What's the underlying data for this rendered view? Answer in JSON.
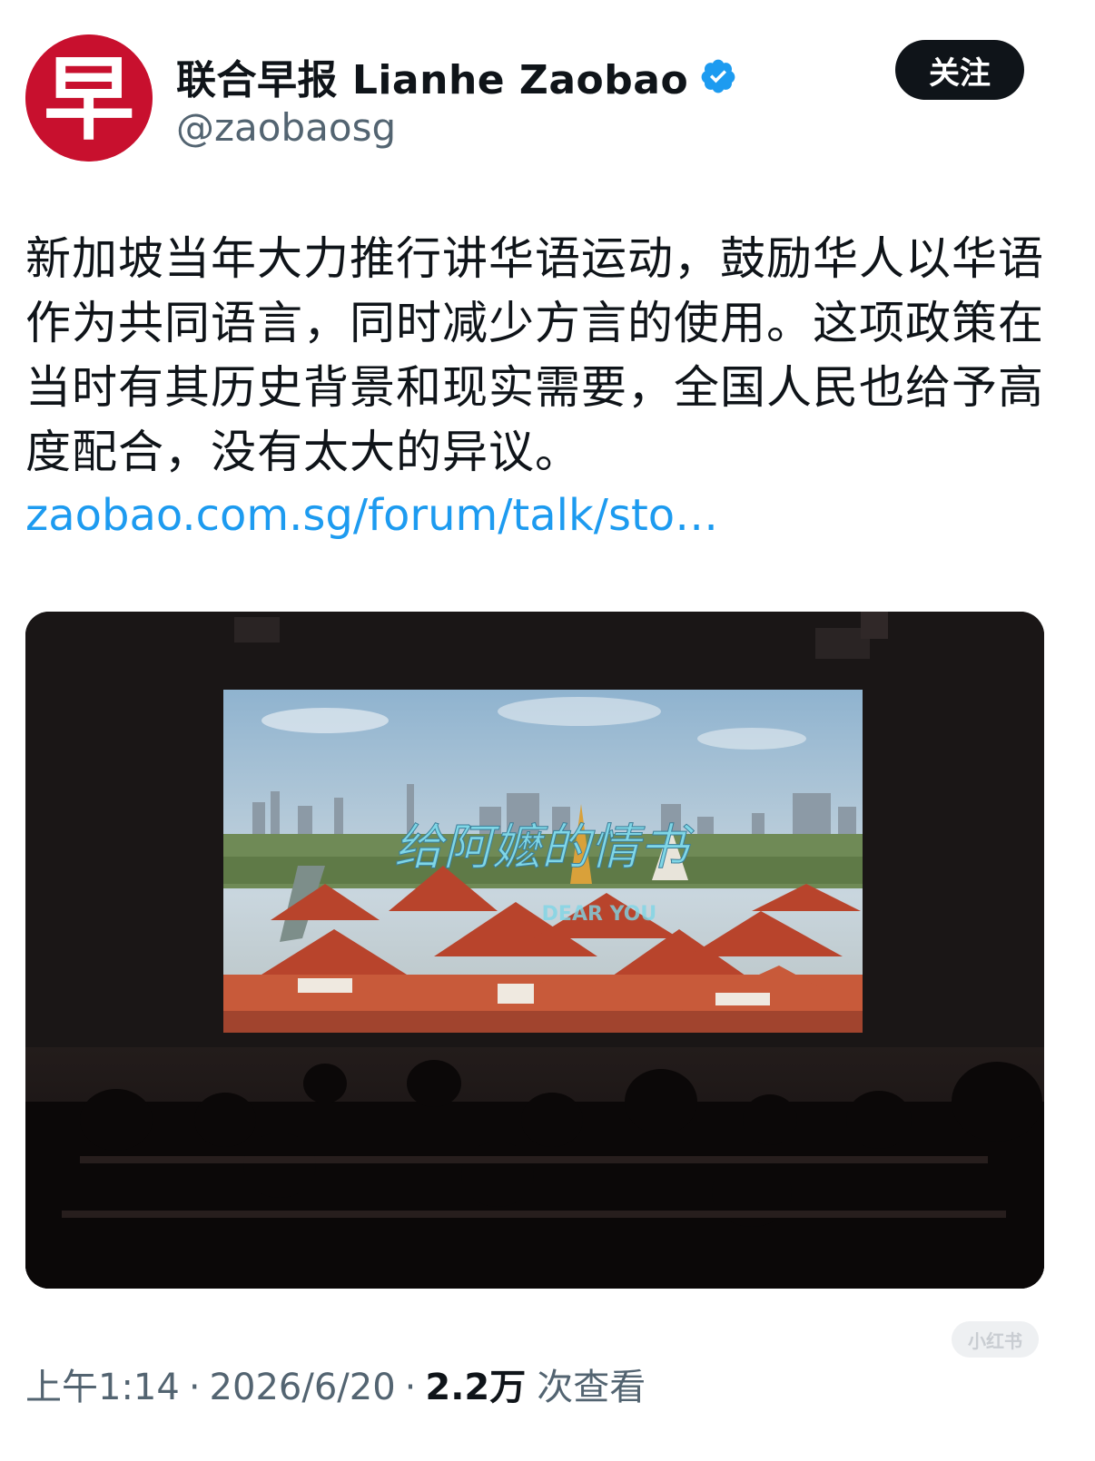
{
  "account": {
    "display_name": "联合早报 Lianhe Zaobao",
    "handle": "@zaobaosg",
    "avatar_glyph": "早",
    "verified": true,
    "follow_label": "关注"
  },
  "tweet": {
    "text": "新加坡当年大力推行讲华语运动，鼓励华人以华语作为共同语言，同时减少方言的使用。这项政策在当时有其历史背景和现实需要，全国人民也给予高度配合，没有太大的异议。",
    "link_text": "zaobao.com.sg/forum/talk/sto…",
    "media": {
      "title_text": "给阿嬷的情书",
      "subtitle_text": "DEAR YOU"
    }
  },
  "meta": {
    "time": "上午1:14",
    "separator": "·",
    "date": "2026/6/20",
    "views_count": "2.2万",
    "views_label": "次查看"
  },
  "watermark": "小红书",
  "colors": {
    "brand_red": "#c8102e",
    "link_blue": "#1d9bf0",
    "verified_blue": "#1d9bf0",
    "button_dark": "#0f1419"
  }
}
